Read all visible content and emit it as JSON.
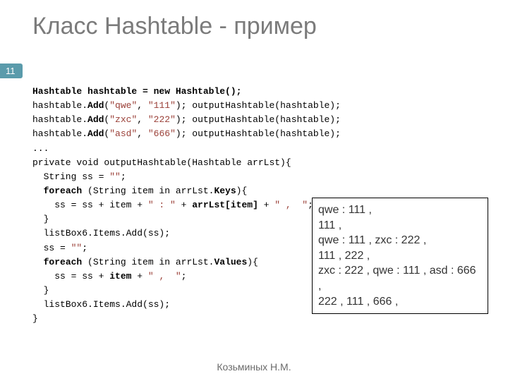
{
  "title": "Класс Hashtable - пример",
  "slide_number": "11",
  "code": {
    "l1a": "Hashtable hashtable = new Hashtable();",
    "l2a": "hashtable.",
    "l2b": "Add",
    "l2c": "(",
    "l2d": "\"qwe\"",
    "l2e": ", ",
    "l2f": "\"111\"",
    "l2g": "); outputHashtable(hashtable);",
    "l3a": "hashtable.",
    "l3b": "Add",
    "l3c": "(",
    "l3d": "\"zxc\"",
    "l3e": ", ",
    "l3f": "\"222\"",
    "l3g": "); outputHashtable(hashtable);",
    "l4a": "hashtable.",
    "l4b": "Add",
    "l4c": "(",
    "l4d": "\"asd\"",
    "l4e": ", ",
    "l4f": "\"666\"",
    "l4g": "); outputHashtable(hashtable);",
    "l5": "...",
    "l6": "private void outputHashtable(Hashtable arrLst){",
    "l7a": "  String ss = ",
    "l7b": "\"\"",
    "l7c": ";",
    "l8a": "  ",
    "l8b": "foreach",
    "l8c": " (String item in arrLst.",
    "l8d": "Keys",
    "l8e": "){",
    "l9a": "    ss = ss + item + ",
    "l9b": "\" : \"",
    "l9c": " + ",
    "l9d": "arrLst[item]",
    "l9e": " + ",
    "l9f": "\" ,  \"",
    "l9g": ";",
    "l10": "  }",
    "l11": "  listBox6.Items.Add(ss);",
    "l12a": "  ss = ",
    "l12b": "\"\"",
    "l12c": ";",
    "l13a": "  ",
    "l13b": "foreach",
    "l13c": " (String item in arrLst.",
    "l13d": "Values",
    "l13e": "){",
    "l14a": "    ss = ss + ",
    "l14b": "item",
    "l14c": " + ",
    "l14d": "\" ,  \"",
    "l14e": ";",
    "l15": "  }",
    "l16": "  listBox6.Items.Add(ss);",
    "l17": "}"
  },
  "output": {
    "l1": "qwe : 111 ,",
    "l2": "111 ,",
    "l3": "qwe : 111 ,  zxc : 222 ,",
    "l4": "111 ,  222 ,",
    "l5": "zxc : 222 ,  qwe : 111 ,  asd : 666 ,",
    "l6": "222 ,  111 ,  666 ,"
  },
  "footer": "Козьминых Н.М."
}
